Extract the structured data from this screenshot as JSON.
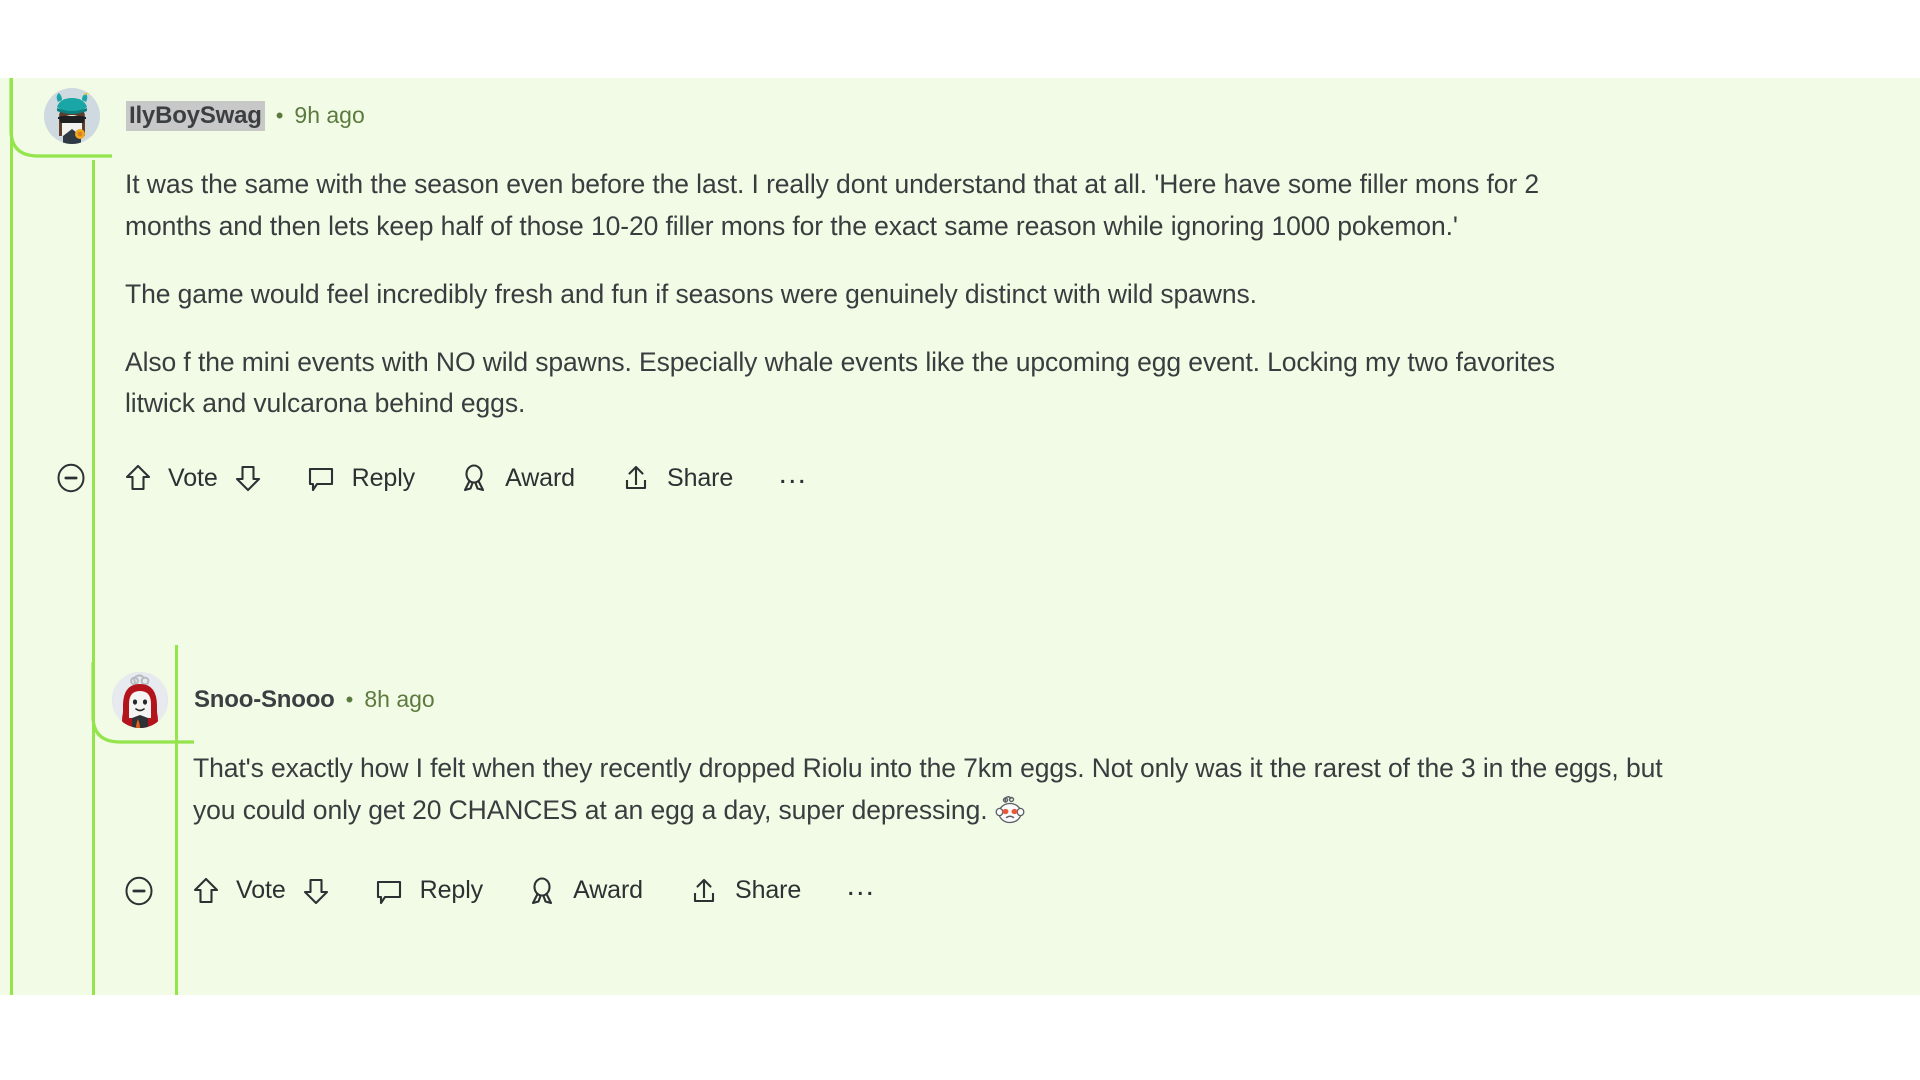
{
  "theme": {
    "highlight_background": "#f1fbe6",
    "page_background": "#ffffff",
    "thread_line_color": "#94e44c",
    "body_text_color": "#3a3d3f",
    "meta_text_color": "#5d7a3e",
    "username_highlight": "#c8c8c8"
  },
  "comments": [
    {
      "author": "IlyBoySwag",
      "separator": "•",
      "timestamp": "9h ago",
      "avatar_icon": "avatar-sunglasses-snoo",
      "paragraphs": [
        "It was the same with the season even before the last. I really dont understand that at all. 'Here have some filler mons for 2 months and then lets keep half of those 10-20 filler mons for the exact same reason while ignoring 1000 pokemon.'",
        "The game would feel incredibly fresh and fun if seasons were genuinely distinct with wild spawns.",
        "Also f the mini events with NO wild spawns. Especially whale events like the upcoming egg event. Locking my two favorites litwick and vulcarona behind eggs."
      ],
      "actions": {
        "collapse_icon": "minus-circle-icon",
        "upvote_icon": "upvote-arrow-icon",
        "vote_label": "Vote",
        "downvote_icon": "downvote-arrow-icon",
        "reply_icon": "comment-bubble-icon",
        "reply_label": "Reply",
        "award_icon": "award-ribbon-icon",
        "award_label": "Award",
        "share_icon": "share-upload-icon",
        "share_label": "Share",
        "more_label": "…"
      }
    },
    {
      "author": "Snoo-Snooo",
      "separator": "•",
      "timestamp": "8h ago",
      "avatar_icon": "avatar-red-hair-snoo",
      "paragraphs": [
        "That's exactly how I felt when they recently dropped Riolu into the 7km eggs. Not only was it the rarest of the 3 in the eggs, but you could only get 20 CHANCES at an egg a day, super depressing."
      ],
      "trailing_emoji": "snoo-blush-worried-emoji",
      "actions": {
        "collapse_icon": "minus-circle-icon",
        "upvote_icon": "upvote-arrow-icon",
        "vote_label": "Vote",
        "downvote_icon": "downvote-arrow-icon",
        "reply_icon": "comment-bubble-icon",
        "reply_label": "Reply",
        "award_icon": "award-ribbon-icon",
        "award_label": "Award",
        "share_icon": "share-upload-icon",
        "share_label": "Share",
        "more_label": "…"
      }
    }
  ]
}
